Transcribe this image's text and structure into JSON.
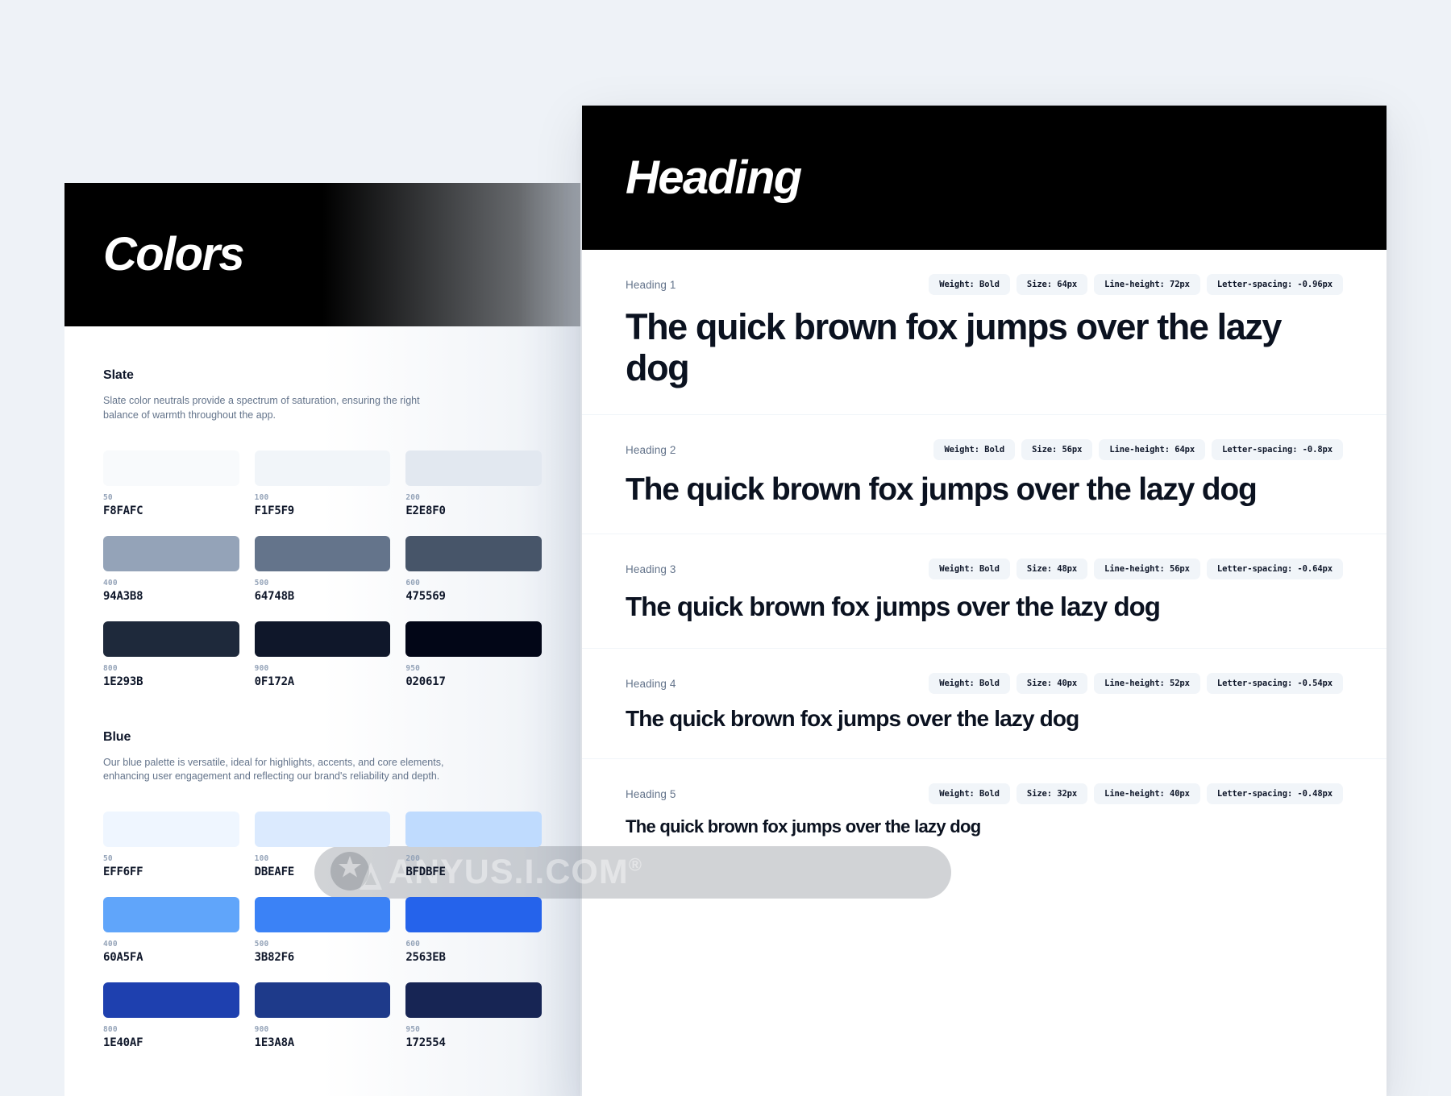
{
  "background_color": "#EEF2F7",
  "colors_panel": {
    "title": "Colors",
    "header_bg": "#000000",
    "groups": [
      {
        "name": "Slate",
        "description": "Slate color neutrals provide a spectrum of saturation, ensuring the right balance of warmth throughout the app.",
        "swatches": [
          {
            "step": "50",
            "hex": "F8FAFC",
            "css": "#F8FAFC"
          },
          {
            "step": "100",
            "hex": "F1F5F9",
            "css": "#F1F5F9"
          },
          {
            "step": "200",
            "hex": "E2E8F0",
            "css": "#E2E8F0"
          },
          {
            "step": "400",
            "hex": "94A3B8",
            "css": "#94A3B8"
          },
          {
            "step": "500",
            "hex": "64748B",
            "css": "#64748B"
          },
          {
            "step": "600",
            "hex": "475569",
            "css": "#475569"
          },
          {
            "step": "800",
            "hex": "1E293B",
            "css": "#1E293B"
          },
          {
            "step": "900",
            "hex": "0F172A",
            "css": "#0F172A"
          },
          {
            "step": "950",
            "hex": "020617",
            "css": "#020617"
          }
        ]
      },
      {
        "name": "Blue",
        "description": "Our blue palette is versatile, ideal for highlights, accents, and core elements, enhancing user engagement and reflecting our brand's reliability and depth.",
        "swatches": [
          {
            "step": "50",
            "hex": "EFF6FF",
            "css": "#EFF6FF"
          },
          {
            "step": "100",
            "hex": "DBEAFE",
            "css": "#DBEAFE"
          },
          {
            "step": "200",
            "hex": "BFDBFE",
            "css": "#BFDBFE"
          },
          {
            "step": "400",
            "hex": "60A5FA",
            "css": "#60A5FA"
          },
          {
            "step": "500",
            "hex": "3B82F6",
            "css": "#3B82F6"
          },
          {
            "step": "600",
            "hex": "2563EB",
            "css": "#2563EB"
          },
          {
            "step": "800",
            "hex": "1E40AF",
            "css": "#1E40AF"
          },
          {
            "step": "900",
            "hex": "1E3A8A",
            "css": "#1E3A8A"
          },
          {
            "step": "950",
            "hex": "172554",
            "css": "#172554"
          }
        ]
      }
    ]
  },
  "heading_panel": {
    "title": "Heading",
    "header_bg": "#000000",
    "sample_text": "The quick brown fox jumps over the lazy dog",
    "rows": [
      {
        "label": "Heading 1",
        "weight": "Weight: Bold",
        "size": "Size: 64px",
        "line_height": "Line-height: 72px",
        "letter_spacing": "Letter-spacing: -0.96px",
        "sample": "The quick brown fox jumps over the lazy dog"
      },
      {
        "label": "Heading 2",
        "weight": "Weight: Bold",
        "size": "Size: 56px",
        "line_height": "Line-height: 64px",
        "letter_spacing": "Letter-spacing: -0.8px",
        "sample": "The quick brown fox jumps over the lazy dog"
      },
      {
        "label": "Heading 3",
        "weight": "Weight: Bold",
        "size": "Size: 48px",
        "line_height": "Line-height: 56px",
        "letter_spacing": "Letter-spacing: -0.64px",
        "sample": "The quick brown fox jumps over the lazy dog"
      },
      {
        "label": "Heading 4",
        "weight": "Weight: Bold",
        "size": "Size: 40px",
        "line_height": "Line-height: 52px",
        "letter_spacing": "Letter-spacing: -0.54px",
        "sample": "The quick brown fox jumps over the lazy dog"
      },
      {
        "label": "Heading 5",
        "weight": "Weight: Bold",
        "size": "Size: 32px",
        "line_height": "Line-height: 40px",
        "letter_spacing": "Letter-spacing: -0.48px",
        "sample": "The quick brown fox jumps over the lazy dog"
      }
    ]
  },
  "watermark": {
    "text": "ANYUS.I.COM",
    "registered_mark": "®"
  }
}
